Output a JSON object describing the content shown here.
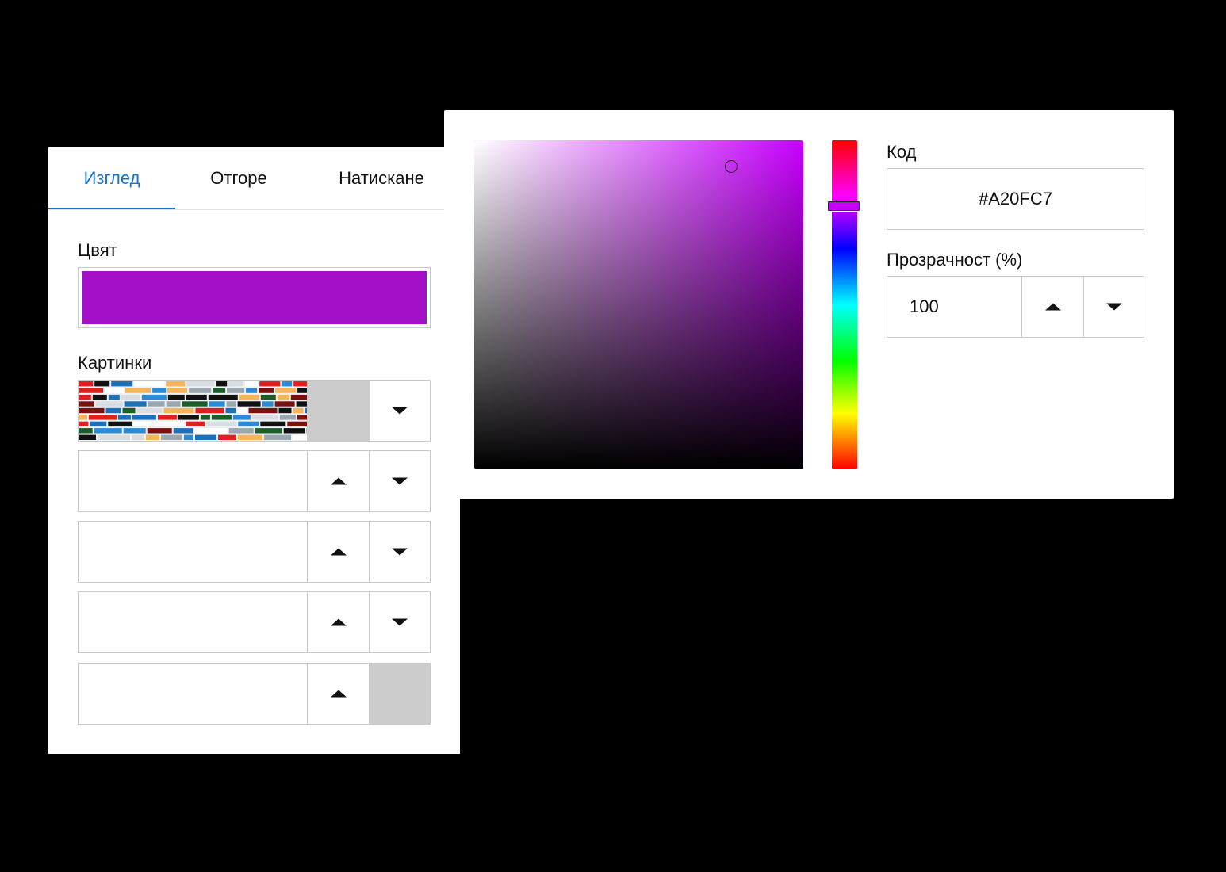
{
  "tabs": [
    {
      "label": "Изглед",
      "active": true
    },
    {
      "label": "Отгоре",
      "active": false
    },
    {
      "label": "Натискане",
      "active": false
    }
  ],
  "panel": {
    "color_label": "Цвят",
    "color_value": "#A20FC7",
    "images_label": "Картинки"
  },
  "picker": {
    "code_label": "Код",
    "code_value": "#A20FC7",
    "opacity_label": "Прозрачност (%)",
    "opacity_value": "100",
    "hue_color": "#C800FF",
    "saturation_pct": 78,
    "brightness_pct": 92,
    "hue_pct": 20
  },
  "icons": {
    "up": "triangle-up-icon",
    "down": "triangle-down-icon"
  },
  "colors": {
    "accent": "#1A73C8",
    "disabled": "#CCCCCC",
    "border": "#C9C9C9"
  }
}
